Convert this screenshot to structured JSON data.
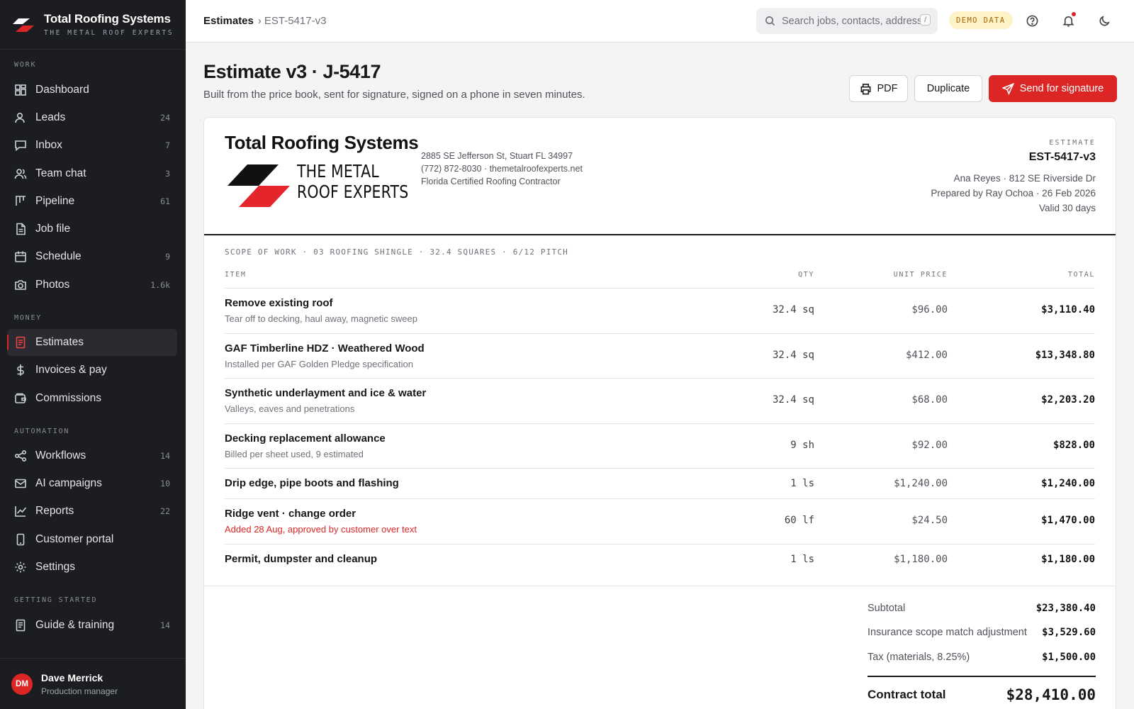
{
  "brand": {
    "name": "Total Roofing Systems",
    "tagline": "THE METAL ROOF EXPERTS"
  },
  "sidebar": {
    "sections": [
      {
        "title": "WORK",
        "items": [
          {
            "label": "Dashboard",
            "icon": "dashboard-icon",
            "count": ""
          },
          {
            "label": "Leads",
            "icon": "user-icon",
            "count": "24"
          },
          {
            "label": "Inbox",
            "icon": "message-icon",
            "count": "7"
          },
          {
            "label": "Team chat",
            "icon": "team-icon",
            "count": "3"
          },
          {
            "label": "Pipeline",
            "icon": "kanban-icon",
            "count": "61"
          },
          {
            "label": "Job file",
            "icon": "file-icon",
            "count": ""
          },
          {
            "label": "Schedule",
            "icon": "calendar-icon",
            "count": "9"
          },
          {
            "label": "Photos",
            "icon": "camera-icon",
            "count": "1.6k"
          }
        ]
      },
      {
        "title": "MONEY",
        "items": [
          {
            "label": "Estimates",
            "icon": "estimate-icon",
            "count": "",
            "active": true
          },
          {
            "label": "Invoices & pay",
            "icon": "dollar-icon",
            "count": ""
          },
          {
            "label": "Commissions",
            "icon": "wallet-icon",
            "count": ""
          }
        ]
      },
      {
        "title": "AUTOMATION",
        "items": [
          {
            "label": "Workflows",
            "icon": "share-icon",
            "count": "14"
          },
          {
            "label": "AI campaigns",
            "icon": "mail-icon",
            "count": "10"
          },
          {
            "label": "Reports",
            "icon": "chart-icon",
            "count": "22"
          },
          {
            "label": "Customer portal",
            "icon": "phone-icon",
            "count": ""
          },
          {
            "label": "Settings",
            "icon": "gear-icon",
            "count": ""
          }
        ]
      },
      {
        "title": "GETTING STARTED",
        "items": [
          {
            "label": "Guide & training",
            "icon": "book-icon",
            "count": "14"
          }
        ]
      }
    ]
  },
  "user": {
    "initials": "DM",
    "name": "Dave Merrick",
    "role": "Production manager"
  },
  "topbar": {
    "breadcrumb": {
      "section": "Estimates",
      "current": "EST-5417-v3"
    },
    "search_placeholder": "Search jobs, contacts, addresses",
    "search_shortcut": "/",
    "demo_badge": "DEMO DATA"
  },
  "page": {
    "title": "Estimate v3 · J-5417",
    "subtitle": "Built from the price book, sent for signature, signed on a phone in seven minutes.",
    "actions": {
      "pdf": "PDF",
      "duplicate": "Duplicate",
      "send": "Send for signature"
    }
  },
  "document": {
    "company": {
      "name": "Total Roofing Systems",
      "line1": "THE METAL",
      "line2": "ROOF EXPERTS",
      "address": "2885 SE Jefferson St, Stuart FL 34997",
      "contact": "(772) 872-8030 · themetalroofexperts.net",
      "license": "Florida Certified Roofing Contractor"
    },
    "meta": {
      "label": "ESTIMATE",
      "number": "EST-5417-v3",
      "customer": "Ana Reyes · 812 SE Riverside Dr",
      "prepared": "Prepared by Ray Ochoa · 26 Feb 2026",
      "validity": "Valid 30 days"
    },
    "scope": "SCOPE OF WORK · 03 ROOFING SHINGLE · 32.4 SQUARES · 6/12 PITCH",
    "columns": {
      "item": "ITEM",
      "qty": "QTY",
      "unit_price": "UNIT PRICE",
      "total": "TOTAL"
    },
    "line_items": [
      {
        "name": "Remove existing roof",
        "desc": "Tear off to decking, haul away, magnetic sweep",
        "qty": "32.4 sq",
        "unit": "$96.00",
        "total": "$3,110.40"
      },
      {
        "name": "GAF Timberline HDZ · Weathered Wood",
        "desc": "Installed per GAF Golden Pledge specification",
        "qty": "32.4 sq",
        "unit": "$412.00",
        "total": "$13,348.80"
      },
      {
        "name": "Synthetic underlayment and ice & water",
        "desc": "Valleys, eaves and penetrations",
        "qty": "32.4 sq",
        "unit": "$68.00",
        "total": "$2,203.20"
      },
      {
        "name": "Decking replacement allowance",
        "desc": "Billed per sheet used, 9 estimated",
        "qty": "9 sh",
        "unit": "$92.00",
        "total": "$828.00"
      },
      {
        "name": "Drip edge, pipe boots and flashing",
        "desc": "",
        "qty": "1 ls",
        "unit": "$1,240.00",
        "total": "$1,240.00"
      },
      {
        "name": "Ridge vent · change order",
        "desc": "Added 28 Aug, approved by customer over text",
        "desc_highlight": true,
        "qty": "60 lf",
        "unit": "$24.50",
        "total": "$1,470.00"
      },
      {
        "name": "Permit, dumpster and cleanup",
        "desc": "",
        "qty": "1 ls",
        "unit": "$1,180.00",
        "total": "$1,180.00"
      }
    ],
    "summary": {
      "subtotal_label": "Subtotal",
      "subtotal": "$23,380.40",
      "adjustment_label": "Insurance scope match adjustment",
      "adjustment": "$3,529.60",
      "tax_label": "Tax (materials, 8.25%)",
      "tax": "$1,500.00",
      "total_label": "Contract total",
      "total": "$28,410.00"
    }
  },
  "colors": {
    "accent": "#dc2626",
    "sidebar_bg": "#1c1d21",
    "badge_bg": "#fef3c7"
  }
}
